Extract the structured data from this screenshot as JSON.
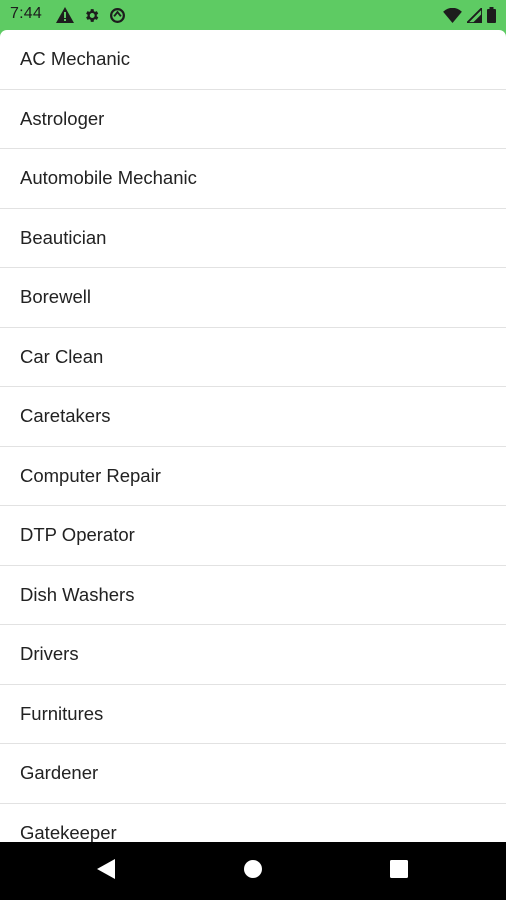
{
  "status_bar": {
    "time": "7:44",
    "left_icons": [
      "warning-icon",
      "gear-icon",
      "data-saver-icon"
    ],
    "right_icons": [
      "wifi-icon",
      "cell-signal-icon",
      "battery-icon"
    ]
  },
  "categories": [
    "AC Mechanic",
    "Astrologer",
    "Automobile Mechanic",
    "Beautician",
    "Borewell",
    "Car Clean",
    "Caretakers",
    "Computer Repair",
    "DTP Operator",
    "Dish Washers",
    "Drivers",
    "Furnitures",
    "Gardener",
    "Gatekeeper"
  ],
  "nav_bar": {
    "icons": [
      "back-icon",
      "home-icon",
      "recents-icon"
    ]
  },
  "colors": {
    "status_bar_bg": "#5ecb63",
    "list_bg": "#ffffff",
    "divider": "#e2e2e2",
    "nav_bar_bg": "#000000"
  }
}
